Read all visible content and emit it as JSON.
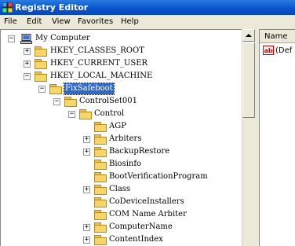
{
  "window": {
    "title": "Registry Editor"
  },
  "menu": [
    "File",
    "Edit",
    "View",
    "Favorites",
    "Help"
  ],
  "tree": {
    "root": "My Computer",
    "hives": [
      "HKEY_CLASSES_ROOT",
      "HKEY_CURRENT_USER",
      "HKEY_LOCAL_MACHINE"
    ],
    "selected": "FixSafeboot",
    "controlset": "ControlSet001",
    "control": "Control",
    "children": [
      {
        "label": "AGP",
        "expandable": false
      },
      {
        "label": "Arbiters",
        "expandable": true
      },
      {
        "label": "BackupRestore",
        "expandable": true
      },
      {
        "label": "Biosinfo",
        "expandable": false
      },
      {
        "label": "BootVerificationProgram",
        "expandable": false
      },
      {
        "label": "Class",
        "expandable": true
      },
      {
        "label": "CoDeviceInstallers",
        "expandable": false
      },
      {
        "label": "COM Name Arbiter",
        "expandable": false
      },
      {
        "label": "ComputerName",
        "expandable": true
      },
      {
        "label": "ContentIndex",
        "expandable": true
      }
    ]
  },
  "list": {
    "column_name": "Name",
    "rows": [
      {
        "icon": "ab",
        "name": "(Def"
      }
    ]
  },
  "colors": {
    "selection": "#316ac5",
    "folder": "#f5d66b"
  }
}
